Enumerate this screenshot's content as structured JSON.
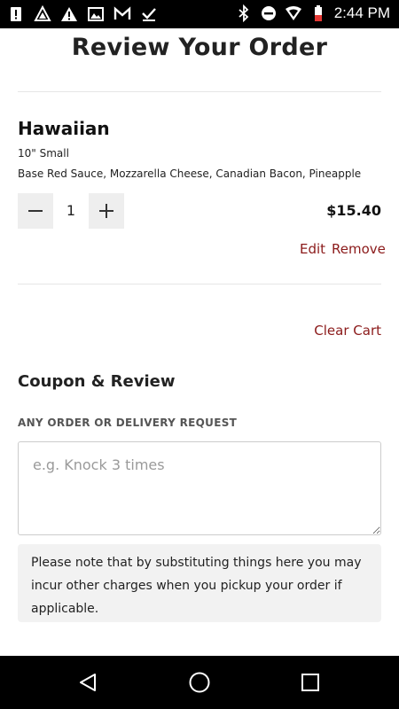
{
  "status_bar": {
    "time": "2:44 PM",
    "left_icons": [
      "notification-alert-icon",
      "triangle-app-icon",
      "warning-icon",
      "image-icon",
      "gmail-icon",
      "checkmark-icon"
    ],
    "right_icons": [
      "bluetooth-icon",
      "do-not-disturb-icon",
      "wifi-icon",
      "battery-icon"
    ]
  },
  "header": {
    "title": "Review Your Order"
  },
  "cart": {
    "items": [
      {
        "name": "Hawaiian",
        "size": "10\" Small",
        "toppings": "Base Red Sauce, Mozzarella Cheese, Canadian Bacon, Pineapple",
        "quantity": "1",
        "price": "$15.40",
        "edit_label": "Edit",
        "remove_label": "Remove"
      }
    ],
    "clear_label": "Clear Cart"
  },
  "coupon_review": {
    "title": "Coupon & Review",
    "request_label": "ANY ORDER OR DELIVERY REQUEST",
    "request_placeholder": "e.g. Knock 3 times",
    "request_value": "",
    "note": "Please note that by substituting things here you may incur other charges when you pickup your order if applicable."
  },
  "colors": {
    "link": "#8b1a1a",
    "button_bg": "#eeeeee",
    "note_bg": "#f2f2f2"
  },
  "nav_bar": {
    "icons": [
      "back-icon",
      "home-icon",
      "recents-icon"
    ]
  }
}
